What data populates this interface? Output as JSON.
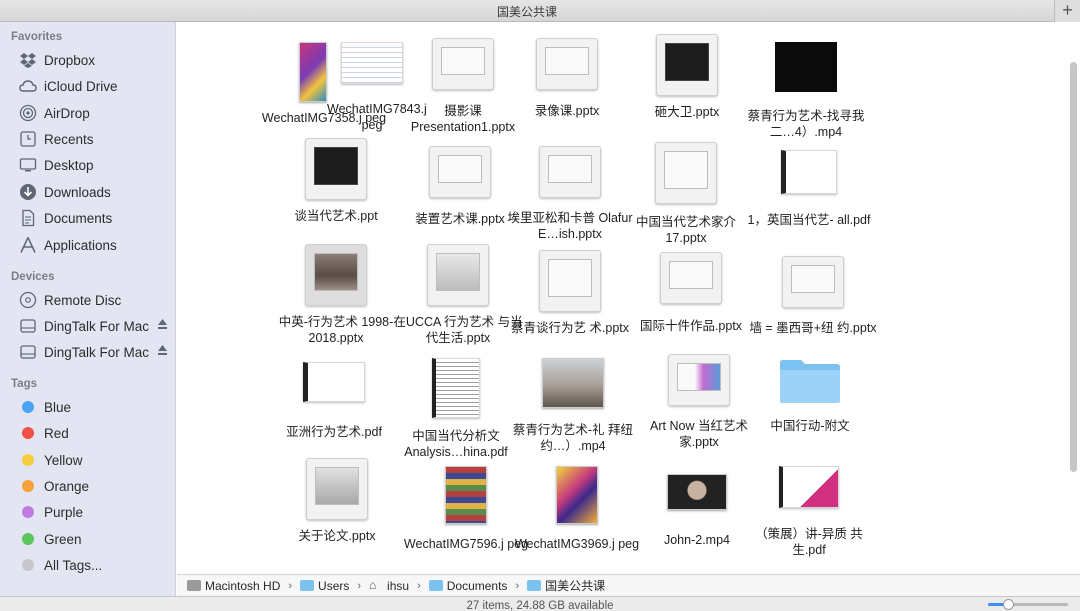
{
  "window": {
    "title": "国美公共课"
  },
  "sidebar": {
    "sections": {
      "favorites": "Favorites",
      "devices": "Devices",
      "tags": "Tags"
    },
    "favorites": [
      {
        "label": "Dropbox",
        "icon": "dropbox-icon"
      },
      {
        "label": "iCloud Drive",
        "icon": "cloud-icon"
      },
      {
        "label": "AirDrop",
        "icon": "airdrop-icon"
      },
      {
        "label": "Recents",
        "icon": "clock-icon"
      },
      {
        "label": "Desktop",
        "icon": "desktop-icon"
      },
      {
        "label": "Downloads",
        "icon": "download-icon"
      },
      {
        "label": "Documents",
        "icon": "document-icon"
      },
      {
        "label": "Applications",
        "icon": "applications-icon"
      }
    ],
    "devices": [
      {
        "label": "Remote Disc",
        "icon": "disc-icon"
      },
      {
        "label": "DingTalk For Mac",
        "icon": "drive-icon"
      },
      {
        "label": "DingTalk For Mac",
        "icon": "drive-icon"
      }
    ],
    "tags": [
      {
        "label": "Blue",
        "color": "#4aa3f5"
      },
      {
        "label": "Red",
        "color": "#f2504b"
      },
      {
        "label": "Yellow",
        "color": "#f6ce3b"
      },
      {
        "label": "Orange",
        "color": "#f6a13a"
      },
      {
        "label": "Purple",
        "color": "#c07be0"
      },
      {
        "label": "Green",
        "color": "#5cc45c"
      },
      {
        "label": "All Tags...",
        "color": "#c8c8cc"
      }
    ]
  },
  "files": [
    {
      "name": "WechatIMG7358.j peg",
      "kind": "photo-stack"
    },
    {
      "name": "WechatIMG7843.j peg",
      "kind": "photo-doc"
    },
    {
      "name": "摄影课 Presentation1.pptx",
      "kind": "slide"
    },
    {
      "name": "录像课.pptx",
      "kind": "slide"
    },
    {
      "name": "砸大卫.pptx",
      "kind": "slide-dark"
    },
    {
      "name": "蔡青行为艺术-找寻我二…4）.mp4",
      "kind": "video-dark"
    },
    {
      "name": "谈当代艺术.ppt",
      "kind": "slide-dark"
    },
    {
      "name": "装置艺术课.pptx",
      "kind": "slide"
    },
    {
      "name": "埃里亚松和卡普 Olafur E…ish.pptx",
      "kind": "slide"
    },
    {
      "name": "中国当代艺术家介 17.pptx",
      "kind": "slide"
    },
    {
      "name": "1，英国当代艺- all.pdf",
      "kind": "pdf"
    },
    {
      "name": "中英-行为艺术 1998-2018.pptx",
      "kind": "slide-photo"
    },
    {
      "name": "在UCCA 行为艺术 与当代生活.pptx",
      "kind": "slide"
    },
    {
      "name": "蔡青谈行为艺 术.pptx",
      "kind": "slide"
    },
    {
      "name": "国际十件作品.pptx",
      "kind": "slide"
    },
    {
      "name": "墙 = 墨西哥+纽 约.pptx",
      "kind": "slide"
    },
    {
      "name": "亚洲行为艺术.pdf",
      "kind": "pdf"
    },
    {
      "name": "中国当代分析文 Analysis…hina.pdf",
      "kind": "pdf-text"
    },
    {
      "name": "蔡青行为艺术-礼 拜纽约…）.mp4",
      "kind": "video-street"
    },
    {
      "name": "Art Now 当红艺术 家.pptx",
      "kind": "slide-color"
    },
    {
      "name": "中国行动-附文",
      "kind": "folder"
    },
    {
      "name": "关于论文.pptx",
      "kind": "slide-grey"
    },
    {
      "name": "WechatIMG7596.j peg",
      "kind": "photo-books"
    },
    {
      "name": "WechatIMG3969.j peg",
      "kind": "photo-yellow"
    },
    {
      "name": "John-2.mp4",
      "kind": "video-person"
    },
    {
      "name": "（策展）讲-异质 共生.pdf",
      "kind": "pdf-pink"
    }
  ],
  "pathbar": [
    "Macintosh HD",
    "Users",
    "ihsu",
    "Documents",
    "国美公共课"
  ],
  "status": {
    "text": "27 items, 24.88 GB available",
    "zoom_fraction": 0.25
  }
}
